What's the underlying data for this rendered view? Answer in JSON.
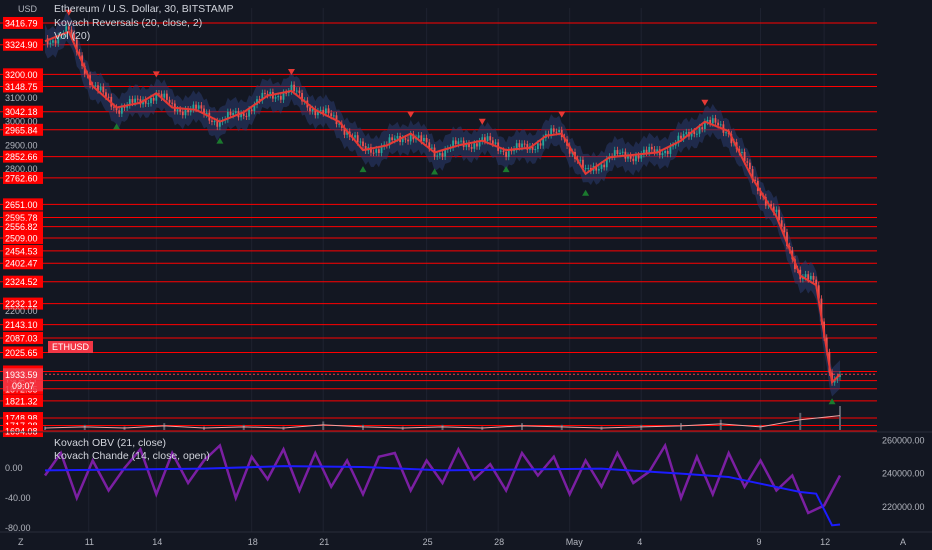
{
  "header": {
    "currency": "USD",
    "title": "Ethereum / U.S. Dollar, 30, BITSTAMP",
    "indicators": [
      "Kovach Reversals (20, close, 2)",
      "Vol (20)"
    ],
    "lower_indicators": [
      "Kovach OBV (21, close)",
      "Kovach Chande (14, close, open)"
    ]
  },
  "ticker": {
    "symbol": "ETHUSD",
    "last_price": "1933.59",
    "countdown": "09:07"
  },
  "colors": {
    "background": "#131722",
    "level_line": "#ff0000",
    "label_bg": "#ff0000",
    "bear": "#ef5350",
    "bull": "#26a69a",
    "signal_up": "#1b7a2e",
    "signal_down": "#e53935",
    "band": "#2a3a6e",
    "ma": "#e53935",
    "obv": "#1c1cff",
    "chande": "#7b1fa2"
  },
  "chart_data": [
    {
      "type": "line",
      "title": "Ethereum / U.S. Dollar, 30, BITSTAMP",
      "ylim": [
        1690,
        3480
      ],
      "x_ticks": [
        "11",
        "14",
        "18",
        "21",
        "25",
        "28",
        "May",
        "4",
        "9",
        "12"
      ],
      "level_lines": [
        3416.79,
        3324.9,
        3200.0,
        3148.75,
        3042.18,
        2965.84,
        2852.66,
        2762.6,
        2651.0,
        2595.78,
        2556.82,
        2509.0,
        2454.53,
        2402.47,
        2324.52,
        2232.12,
        2143.1,
        2087.03,
        2025.65,
        1945.37,
        1906.71,
        1872.55,
        1821.32,
        1748.98,
        1717.28,
        1694.08
      ],
      "price_axis_ticks": [
        "3100.00",
        "3000.00",
        "2900.00",
        "2800.00",
        "2200.00"
      ],
      "series": [
        {
          "name": "ETHUSD",
          "x": [
            0,
            3,
            6,
            9,
            12,
            14,
            16,
            19,
            22,
            25,
            28,
            31,
            34,
            37,
            40,
            43,
            46,
            49,
            52,
            55,
            58,
            61,
            63,
            65,
            68,
            71,
            74,
            77,
            80,
            83,
            86,
            89,
            92,
            95,
            97,
            99,
            100
          ],
          "values": [
            3340,
            3380,
            3150,
            3060,
            3080,
            3120,
            3060,
            3050,
            3000,
            3040,
            3110,
            3130,
            3050,
            3000,
            2880,
            2900,
            2950,
            2870,
            2900,
            2920,
            2880,
            2890,
            2940,
            2950,
            2780,
            2850,
            2860,
            2870,
            2920,
            3000,
            2960,
            2760,
            2600,
            2350,
            2310,
            1900,
            1933
          ]
        }
      ]
    },
    {
      "type": "bar",
      "series_note": "Vol (20)",
      "x": [
        0,
        5,
        10,
        15,
        20,
        25,
        30,
        35,
        40,
        45,
        50,
        55,
        60,
        65,
        70,
        75,
        80,
        85,
        90,
        95,
        100
      ],
      "values": [
        2,
        3,
        2,
        4,
        2,
        3,
        2,
        5,
        3,
        2,
        3,
        2,
        4,
        3,
        2,
        3,
        4,
        6,
        3,
        10,
        14
      ]
    },
    {
      "type": "line",
      "title": "Kovach OBV (21, close) / Kovach Chande (14, close, open)",
      "left_axis_ticks": [
        "0.00",
        "-40.00",
        "-80.00"
      ],
      "right_axis_ticks": [
        "260000.00",
        "240000.00",
        "220000.00"
      ],
      "series": [
        {
          "name": "Kovach OBV (21, close)",
          "x": [
            0,
            10,
            20,
            30,
            40,
            50,
            60,
            70,
            80,
            86,
            90,
            93,
            95,
            97,
            99,
            100
          ],
          "values": [
            242000,
            242500,
            243000,
            244500,
            244000,
            242000,
            242500,
            243000,
            240000,
            238000,
            234000,
            231000,
            229000,
            228000,
            209000,
            209500
          ]
        },
        {
          "name": "Kovach Chande (14, close, open)",
          "x": [
            0,
            2,
            4,
            6,
            8,
            10,
            12,
            14,
            16,
            18,
            20,
            22,
            24,
            26,
            28,
            30,
            32,
            34,
            36,
            38,
            40,
            42,
            44,
            46,
            48,
            50,
            52,
            54,
            56,
            58,
            60,
            62,
            64,
            66,
            68,
            70,
            72,
            74,
            76,
            78,
            80,
            82,
            84,
            86,
            88,
            90,
            92,
            94,
            96,
            98,
            100
          ],
          "values": [
            -10,
            20,
            -40,
            10,
            -30,
            0,
            25,
            -35,
            20,
            -20,
            10,
            30,
            -40,
            15,
            -15,
            25,
            -30,
            20,
            -25,
            10,
            -35,
            15,
            20,
            -30,
            10,
            -20,
            25,
            -15,
            5,
            -30,
            20,
            -10,
            15,
            -35,
            10,
            -25,
            20,
            -20,
            -5,
            30,
            -40,
            15,
            -35,
            20,
            -25,
            10,
            -30,
            -10,
            -60,
            -50,
            -10
          ]
        }
      ]
    }
  ]
}
